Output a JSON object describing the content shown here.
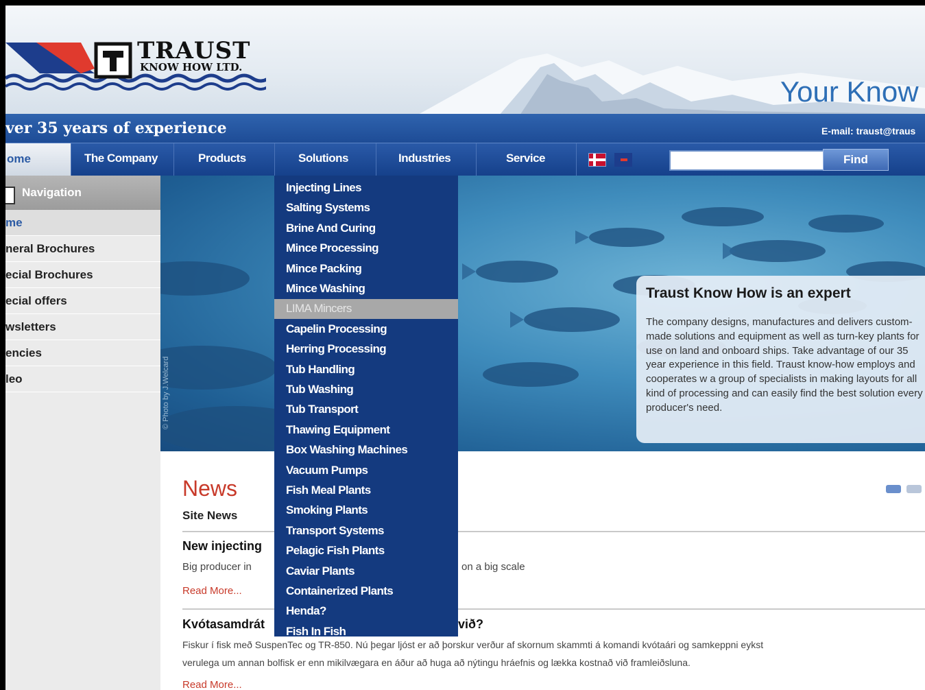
{
  "header": {
    "logo_word": "TRAUST",
    "logo_sub": "KNOW HOW LTD.",
    "tagline_right": "Your Know",
    "strip_left": "ver 35 years of experience",
    "email": "E-mail: traust@traus"
  },
  "nav": {
    "items": [
      "ome",
      "The Company",
      "Products",
      "Solutions",
      "Industries",
      "Service"
    ],
    "search_placeholder": "",
    "find_label": "Find"
  },
  "sidebar": {
    "heading": "Navigation",
    "items": [
      "me",
      "neral Brochures",
      "ecial Brochures",
      "ecial offers",
      "wsletters",
      "encies",
      "leo"
    ]
  },
  "dropdown": {
    "items": [
      "Injecting Lines",
      "Salting Systems",
      "Brine And Curing",
      "Mince Processing",
      "Mince Packing",
      "Mince Washing",
      "LIMA Mincers",
      "Capelin Processing",
      "Herring Processing",
      "Tub Handling",
      "Tub Washing",
      "Tub Transport",
      "Thawing Equipment",
      "Box Washing Machines",
      "Vacuum Pumps",
      "Fish Meal Plants",
      "Smoking Plants",
      "Transport Systems",
      "Pelagic Fish Plants",
      "Caviar Plants",
      "Containerized Plants",
      "Henda?",
      "Fish In Fish"
    ],
    "highlighted_index": 6
  },
  "hero": {
    "credit": "© Photo by J.Welcard",
    "info_title": "Traust Know How is an expert",
    "info_text": "The company designs, manufactures and delivers custom-made solutions and equipment as well as turn-key plants for use on land and onboard ships. Take advantage of our 35 year experience in this field. Traust know-how employs and cooperates w a group of specialists in making layouts for all kind of processing and can easily find the best solution every producer's need."
  },
  "news": {
    "title": "News",
    "subtitle": "Site News",
    "items": [
      {
        "title": "New injecting",
        "text_left": "Big producer in",
        "text_right": "on a big scale",
        "more": "Read More..."
      },
      {
        "title": "Kvótasamdrát",
        "title_right": "við?",
        "text_line1": "Fiskur í fisk með SuspenTec og TR-850. Nú þegar ljóst er að þorskur verður af skornum skammti á komandi kvótaári og samkeppni eykst",
        "text_line2": "verulega um annan bolfisk er enn mikilvægara en áður að huga að nýtingu hráefnis og lækka kostnað við framleiðsluna.",
        "more": "Read More..."
      }
    ]
  },
  "colors": {
    "brand_blue": "#1c4a94",
    "accent_red": "#c83a2a"
  }
}
